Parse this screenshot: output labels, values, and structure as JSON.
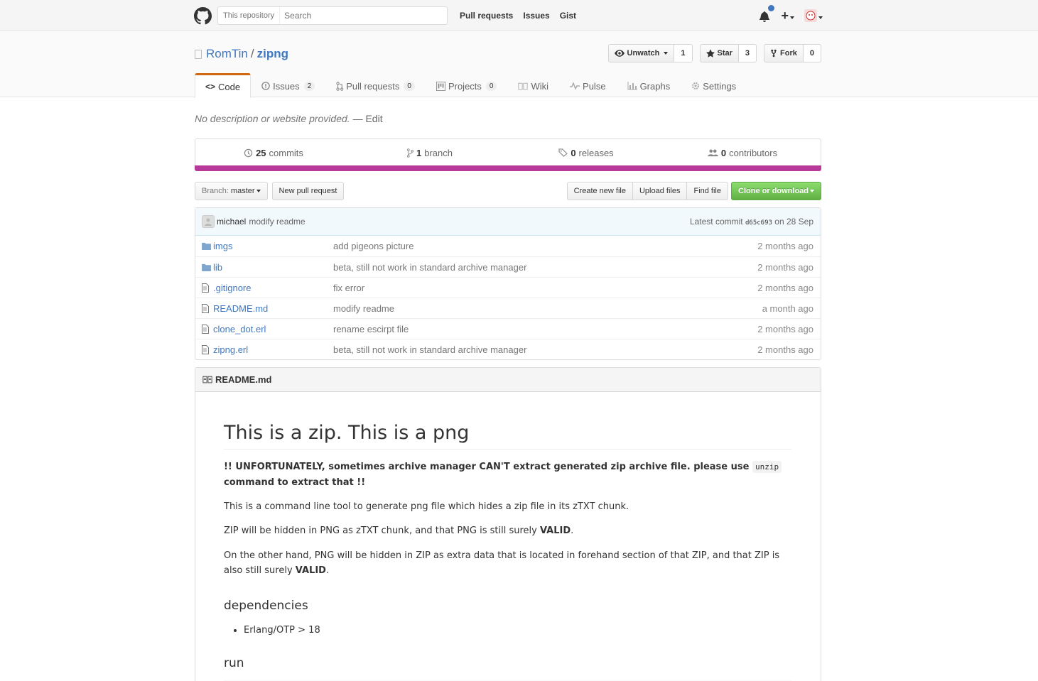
{
  "header": {
    "search_scope": "This repository",
    "search_placeholder": "Search",
    "nav": [
      "Pull requests",
      "Issues",
      "Gist"
    ]
  },
  "repo": {
    "owner": "RomTin",
    "separator": "/",
    "name": "zipng",
    "watch_label": "Unwatch",
    "watch_count": "1",
    "star_label": "Star",
    "star_count": "3",
    "fork_label": "Fork",
    "fork_count": "0"
  },
  "tabs": [
    {
      "label": "Code",
      "counter": ""
    },
    {
      "label": "Issues",
      "counter": "2"
    },
    {
      "label": "Pull requests",
      "counter": "0"
    },
    {
      "label": "Projects",
      "counter": "0"
    },
    {
      "label": "Wiki",
      "counter": ""
    },
    {
      "label": "Pulse",
      "counter": ""
    },
    {
      "label": "Graphs",
      "counter": ""
    },
    {
      "label": "Settings",
      "counter": ""
    }
  ],
  "description": {
    "text": "No description or website provided.",
    "dash": "—",
    "edit": "Edit"
  },
  "summary": {
    "commits_num": "25",
    "commits_label": "commits",
    "branch_num": "1",
    "branch_label": "branch",
    "releases_num": "0",
    "releases_label": "releases",
    "contributors_num": "0",
    "contributors_label": "contributors",
    "language_color": "#b83998"
  },
  "filenav": {
    "branch_prefix": "Branch:",
    "branch": "master",
    "new_pr": "New pull request",
    "create_file": "Create new file",
    "upload_files": "Upload files",
    "find_file": "Find file",
    "clone": "Clone or download"
  },
  "commit": {
    "author": "michael",
    "message": "modify readme",
    "latest_label": "Latest commit",
    "sha": "d65c693",
    "date": "on 28 Sep"
  },
  "files": [
    {
      "name": "imgs",
      "type": "dir",
      "message": "add pigeons picture",
      "age": "2 months ago"
    },
    {
      "name": "lib",
      "type": "dir",
      "message": "beta, still not work in standard archive manager",
      "age": "2 months ago"
    },
    {
      "name": ".gitignore",
      "type": "file",
      "message": "fix error",
      "age": "2 months ago"
    },
    {
      "name": "README.md",
      "type": "file",
      "message": "modify readme",
      "age": "a month ago"
    },
    {
      "name": "clone_dot.erl",
      "type": "file",
      "message": "rename escirpt file",
      "age": "2 months ago"
    },
    {
      "name": "zipng.erl",
      "type": "file",
      "message": "beta, still not work in standard archive manager",
      "age": "2 months ago"
    }
  ],
  "readme": {
    "filename": "README.md",
    "title": "This is a zip. This is a png",
    "warning_pre": "!! UNFORTUNATELY, sometimes archive manager CAN'T extract generated zip archive file. please use",
    "warning_code": "unzip",
    "warning_post": "command to extract that !!",
    "p1": "This is a command line tool to generate png file which hides a zip file in its zTXT chunk.",
    "p2_pre": "ZIP will be hidden in PNG as zTXT chunk, and that PNG is still surely",
    "p2_bold": "VALID",
    "p2_post": ".",
    "p3_pre": "On the other hand, PNG will be hidden in ZIP as extra data that is located in forehand section of that ZIP, and that ZIP is also still surely",
    "p3_bold": "VALID",
    "p3_post": ".",
    "h_dependencies": "dependencies",
    "dependency": "Erlang/OTP > 18",
    "h_run": "run"
  }
}
